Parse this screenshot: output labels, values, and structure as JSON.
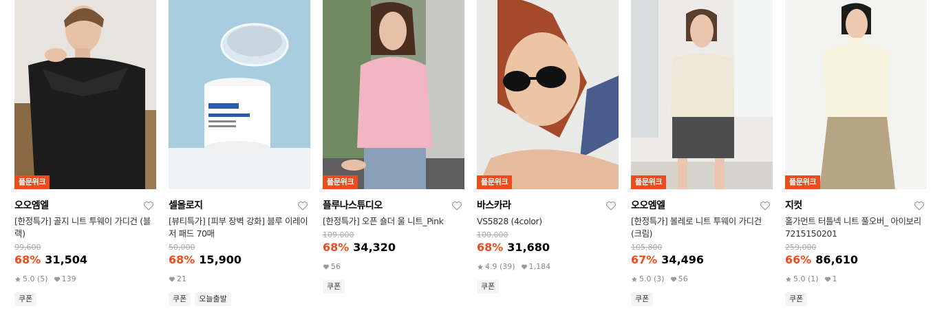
{
  "colors": {
    "accent": "#ee4b1e",
    "tag_bg": "#f4f4f4",
    "muted": "#888888"
  },
  "products": [
    {
      "badge": "풀문위크",
      "brand": "오오엠엘",
      "name": "[한정특가] 골지 니트 투웨이 가디건 (블랙)",
      "original_price": "99,600",
      "discount": "68%",
      "price": "31,504",
      "rating": "5.0",
      "reviews": "(5)",
      "likes": "139",
      "tags": [
        "쿠폰"
      ]
    },
    {
      "badge": "",
      "brand": "셀올로지",
      "name": "[뷰티특가] [피부 장벽 강화] 블루 이레이저 패드 70매",
      "original_price": "50,000",
      "discount": "68%",
      "price": "15,900",
      "rating": "",
      "reviews": "",
      "likes": "21",
      "tags": [
        "쿠폰",
        "오늘출발"
      ]
    },
    {
      "badge": "풀문위크",
      "brand": "플루나스튜디오",
      "name": "[한정특가] 오픈 숄더 울 니트_Pink",
      "original_price": "109,000",
      "discount": "68%",
      "price": "34,320",
      "rating": "",
      "reviews": "",
      "likes": "56",
      "tags": [
        "쿠폰"
      ]
    },
    {
      "badge": "풀문위크",
      "brand": "바스카라",
      "name": "VS5828 (4color)",
      "original_price": "100,000",
      "discount": "68%",
      "price": "31,680",
      "rating": "4.9",
      "reviews": "(39)",
      "likes": "1,184",
      "tags": [
        "쿠폰"
      ]
    },
    {
      "badge": "풀문위크",
      "brand": "오오엠엘",
      "name": "[한정특가] 볼레로 니트 투웨이 가디건 (크림)",
      "original_price": "105,800",
      "discount": "67%",
      "price": "34,496",
      "rating": "5.0",
      "reviews": "(3)",
      "likes": "56",
      "tags": [
        "쿠폰"
      ]
    },
    {
      "badge": "풀문위크",
      "brand": "지컷",
      "name": "홀가먼트 터틀넥 니트 풀오버_ 아이보리 7215150201",
      "original_price": "259,000",
      "discount": "66%",
      "price": "86,610",
      "rating": "5.0",
      "reviews": "(1)",
      "likes": "1",
      "tags": [
        "쿠폰"
      ]
    }
  ],
  "icons": {
    "wishlist": "heart-outline-icon",
    "rating": "star-icon",
    "likes": "heart-filled-icon"
  }
}
